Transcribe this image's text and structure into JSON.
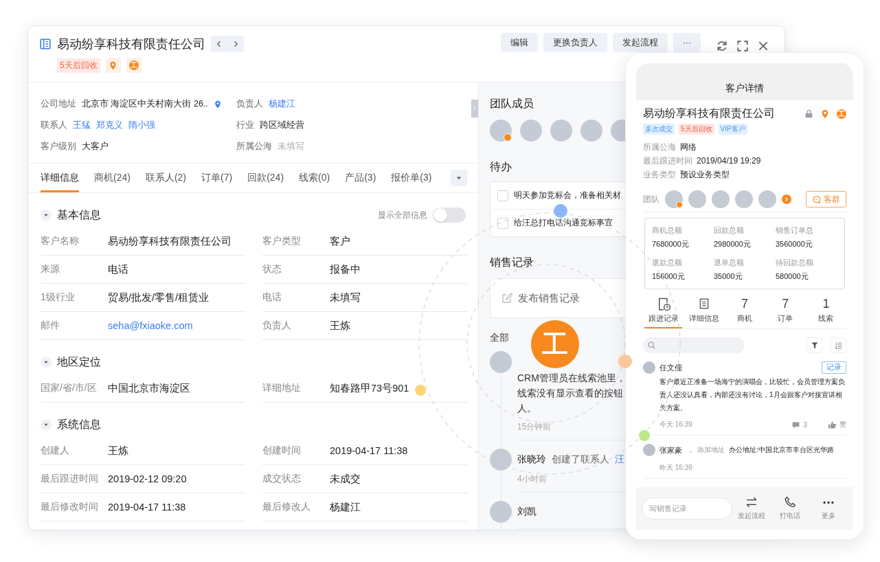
{
  "window": {
    "title": "易动纷享科技有限责任公司",
    "tags": [
      "5天后回收"
    ],
    "logo_glyph": "工",
    "actions": [
      "编辑",
      "更换负责人",
      "发起流程",
      "···"
    ]
  },
  "summary": [
    {
      "label": "公司地址",
      "kind": "address",
      "value": "北京市 海淀区中关村南大街 26.."
    },
    {
      "label": "负责人",
      "kind": "link",
      "value": "杨建江"
    },
    {
      "label": "联系人",
      "kind": "links",
      "values": [
        "王猛",
        "郑克义",
        "隋小强"
      ]
    },
    {
      "label": "行业",
      "kind": "text",
      "value": "跨区域经营"
    },
    {
      "label": "客户级别",
      "kind": "text",
      "value": "大客户"
    },
    {
      "label": "所属公海",
      "kind": "empty",
      "value": "未填写"
    }
  ],
  "tabs": [
    {
      "label": "详细信息",
      "selected": true
    },
    {
      "label": "商机(24)",
      "selected": false
    },
    {
      "label": "联系人(2)",
      "selected": false
    },
    {
      "label": "订单(7)",
      "selected": false
    },
    {
      "label": "回款(24)",
      "selected": false
    },
    {
      "label": "线索(0)",
      "selected": false
    },
    {
      "label": "产品(3)",
      "selected": false
    },
    {
      "label": "报价单(3)",
      "selected": false
    }
  ],
  "sections": [
    {
      "title": "基本信息",
      "expanded": true,
      "toggle": {
        "label": "显示全部信息",
        "on": false
      },
      "fields": [
        {
          "label": "客户名称",
          "value": "易动纷享科技有限责任公司"
        },
        {
          "label": "客户类型",
          "value": "客户"
        },
        {
          "label": "来源",
          "value": "电话"
        },
        {
          "label": "状态",
          "value": "报备中"
        },
        {
          "label": "1级行业",
          "value": "贸易/批发/零售/租赁业"
        },
        {
          "label": "电话",
          "value": "未填写"
        },
        {
          "label": "邮件",
          "value": "seha@fxiaoke.com",
          "kind": "link"
        },
        {
          "label": "负责人",
          "value": "王炼"
        }
      ]
    },
    {
      "title": "地区定位",
      "expanded": true,
      "fields": [
        {
          "label": "国家/省/市/区",
          "value": "中国北京市海淀区"
        },
        {
          "label": "详细地址",
          "value": "知春路甲73号901"
        }
      ]
    },
    {
      "title": "系统信息",
      "expanded": true,
      "fields": [
        {
          "label": "创建人",
          "value": "王炼"
        },
        {
          "label": "创建时间",
          "value": "2019-04-17 11:38"
        },
        {
          "label": "最后跟进时间",
          "value": "2019-02-12 09:20"
        },
        {
          "label": "成交状态",
          "value": "未成交"
        },
        {
          "label": "最后修改时间",
          "value": "2019-04-17 11:38"
        },
        {
          "label": "最后修改人",
          "value": "杨建江"
        }
      ]
    }
  ],
  "team": {
    "title": "团队成员",
    "members": [
      {
        "owner": true
      },
      {
        "owner": false
      },
      {
        "owner": false
      },
      {
        "owner": false
      },
      {
        "owner": false
      }
    ]
  },
  "todo": {
    "title": "待办",
    "items": [
      {
        "text": "明天参加竞标会，准备相关材",
        "checked": false
      },
      {
        "text": "给汪总打电话沟通竞标事宜",
        "checked": false
      }
    ]
  },
  "sales": {
    "title": "销售记录",
    "compose": "发布销售记录",
    "filter": "全部",
    "feed": [
      {
        "text_lines": [
          "CRM管理员在线索池里，",
          "线索没有显示查看的按钮",
          "人。"
        ],
        "time": "15分钟前"
      },
      {
        "author": "张晓玲",
        "action": "创建了联系人",
        "link": "汪",
        "time": "4小时前"
      },
      {
        "author": "刘凯"
      }
    ]
  },
  "badge_glyph": "工",
  "phone": {
    "title": "客户详情",
    "company": "易动纷享科技有限责任公司",
    "logo_glyph": "工",
    "tags": [
      {
        "label": "多次成交",
        "color": "#e2effd"
      },
      {
        "label": "5天后回收",
        "color": "#fde6e3"
      },
      {
        "label": "VIP客户",
        "color": "#e2effd"
      }
    ],
    "fields": [
      {
        "label": "所属公海",
        "value": "网络"
      },
      {
        "label": "最后跟进时间",
        "value": "2019/04/19 19:29"
      },
      {
        "label": "业务类型",
        "value": "预设业务类型"
      }
    ],
    "team": {
      "label": "团队",
      "members": [
        {
          "owner": true
        },
        {
          "owner": false
        },
        {
          "owner": false
        },
        {
          "owner": false
        },
        {
          "owner": false
        }
      ],
      "group_button": "客群"
    },
    "stats": [
      {
        "label": "商机总额",
        "value": "7680000元"
      },
      {
        "label": "回款总额",
        "value": "2980000元"
      },
      {
        "label": "销售订单总",
        "value": "3560000元"
      },
      {
        "label": "退款总额",
        "value": "156000元"
      },
      {
        "label": "退单总额",
        "value": "35000元"
      },
      {
        "label": "待回款总额",
        "value": "580000元"
      }
    ],
    "tabs": [
      {
        "kind": "history",
        "label": "跟进记录",
        "selected": true
      },
      {
        "kind": "details",
        "label": "详细信息",
        "selected": false
      },
      {
        "kind": "count",
        "count": "7",
        "label": "商机",
        "selected": false
      },
      {
        "kind": "count",
        "count": "7",
        "label": "订单",
        "selected": false
      },
      {
        "kind": "count",
        "count": "1",
        "label": "线索",
        "selected": false
      }
    ],
    "records": [
      {
        "author": "任文儒",
        "tag": "记录",
        "text": "客户最近正准备一场海宁的演唱会，比较忙，会员管理方案负责人还没认真看，内部还没有讨论，1月会跟客户对接宣讲相关方案。",
        "time": "今天 16:39",
        "comments": "3",
        "like": "赞"
      },
      {
        "author": "张家豪",
        "arrow": "→",
        "action": "添加地址",
        "detail": "办公地址:中国北京市丰台区光华路",
        "time": "昨天 16:39"
      }
    ],
    "composer": {
      "placeholder": "写销售记录"
    },
    "actions": [
      {
        "kind": "flow",
        "label": "发起流程"
      },
      {
        "kind": "call",
        "label": "打电话"
      },
      {
        "kind": "more",
        "label": "更多"
      }
    ]
  }
}
